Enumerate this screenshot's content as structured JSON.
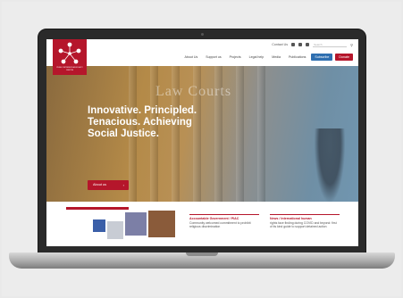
{
  "site": {
    "logo_text": "PUBLIC INTEREST ADVOCACY CENTRE",
    "util_nav": {
      "contact": "Contact Us",
      "search_placeholder": "Search"
    },
    "main_nav": [
      "About Us",
      "Support us",
      "Projects",
      "Legal help",
      "Media",
      "Publications"
    ],
    "news_button": "Subscribe",
    "donate_button": "Donate"
  },
  "hero": {
    "sign": "Law Courts",
    "headline_line1": "Innovative. Principled.",
    "headline_line2": "Tenacious. Achieving",
    "headline_line3": "Social Justice.",
    "cta_label": "About us",
    "cta_arrow": "›"
  },
  "cards": [
    {
      "title": "Accountable Government / PIAC",
      "body": "Community welcomed commitment to prohibit religious discrimination"
    },
    {
      "title": "News / International human",
      "body": "rights face finding during COVID and beyond: first of its kind guide to support detained action"
    }
  ],
  "colors": {
    "brand_red": "#b5162b",
    "accent_blue": "#2f6fb0"
  }
}
